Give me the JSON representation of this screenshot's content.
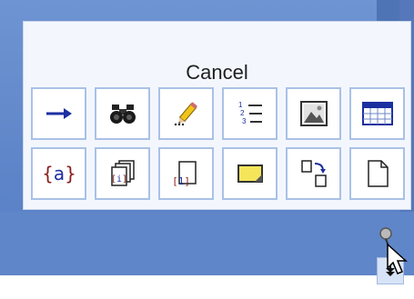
{
  "popup": {
    "cancel_label": "Cancel"
  },
  "tiles": [
    {
      "icon": "arrow-right-icon"
    },
    {
      "icon": "binoculars-icon"
    },
    {
      "icon": "pencil-icon"
    },
    {
      "icon": "numbered-list-icon"
    },
    {
      "icon": "picture-icon"
    },
    {
      "icon": "table-icon"
    },
    {
      "icon": "variable-braces-icon",
      "text": "{a}"
    },
    {
      "icon": "stacked-pages-index-icon",
      "text": "[i]"
    },
    {
      "icon": "page-index-icon",
      "text": "[i]"
    },
    {
      "icon": "sticky-note-icon"
    },
    {
      "icon": "swap-boxes-icon"
    },
    {
      "icon": "blank-page-icon"
    }
  ],
  "colors": {
    "background_blue": "#5f86c9",
    "popup_bg": "#f3f7fd",
    "tile_border": "#a9c1e6",
    "icon_blue": "#1b2fa0",
    "icon_red": "#8b1a1a"
  }
}
